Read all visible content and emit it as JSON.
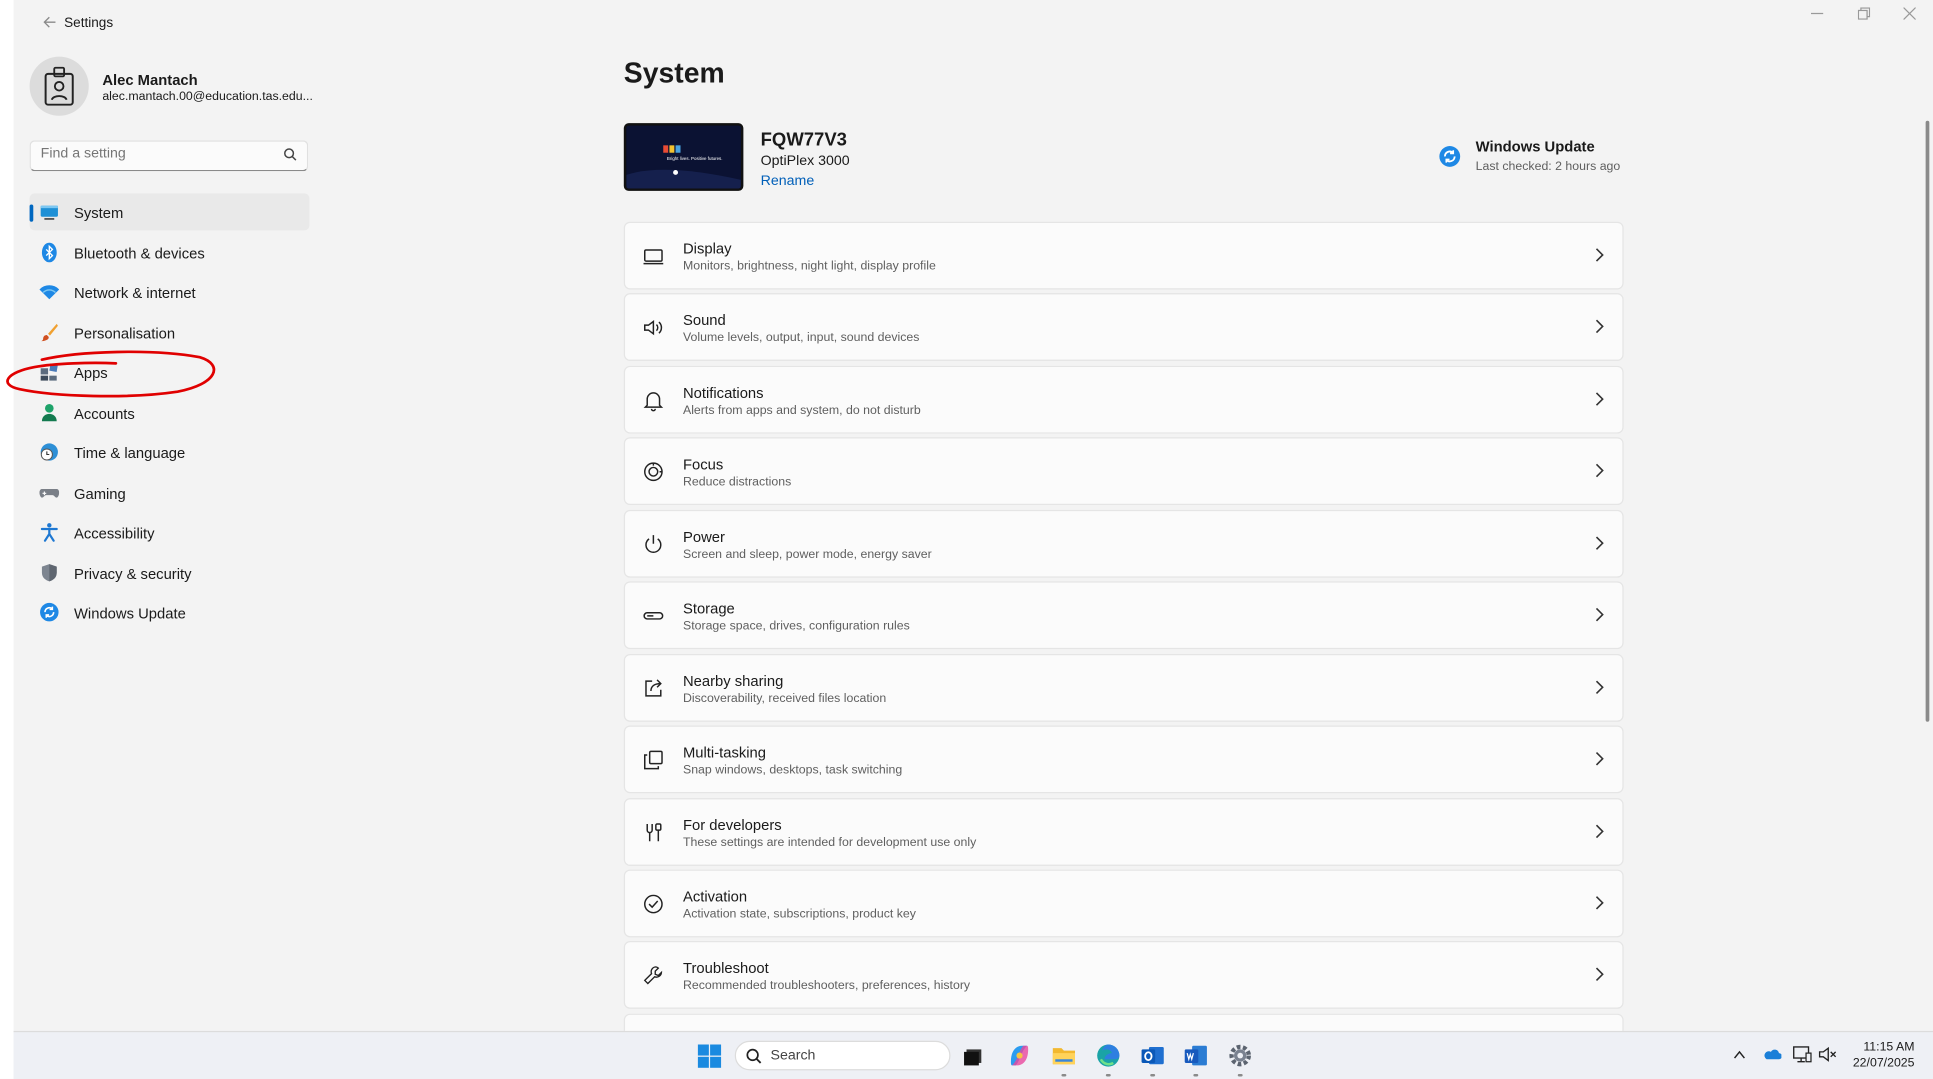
{
  "window": {
    "title": "Settings",
    "back_icon": "back-arrow-icon",
    "controls": [
      "minimize-icon",
      "restore-icon",
      "close-icon"
    ]
  },
  "profile": {
    "name": "Alec Mantach",
    "email": "alec.mantach.00@education.tas.edu...."
  },
  "search": {
    "placeholder": "Find a setting"
  },
  "nav": {
    "items": [
      {
        "label": "System",
        "icon": "system-display-icon",
        "active": true
      },
      {
        "label": "Bluetooth & devices",
        "icon": "bluetooth-icon"
      },
      {
        "label": "Network & internet",
        "icon": "wifi-icon"
      },
      {
        "label": "Personalisation",
        "icon": "paintbrush-icon"
      },
      {
        "label": "Apps",
        "icon": "apps-icon"
      },
      {
        "label": "Accounts",
        "icon": "person-icon"
      },
      {
        "label": "Time & language",
        "icon": "globe-clock-icon"
      },
      {
        "label": "Gaming",
        "icon": "gamepad-icon"
      },
      {
        "label": "Accessibility",
        "icon": "accessibility-icon"
      },
      {
        "label": "Privacy & security",
        "icon": "shield-icon"
      },
      {
        "label": "Windows Update",
        "icon": "windows-update-icon"
      }
    ]
  },
  "annotation": {
    "description": "red hand-drawn circle around Apps",
    "color": "#e00000"
  },
  "main": {
    "title": "System",
    "device": {
      "name": "FQW77V3",
      "model": "OptiPlex 3000",
      "rename_label": "Rename",
      "wallpaper_text": "Bright lives. Positive futures."
    },
    "windows_update": {
      "title": "Windows Update",
      "status": "Last checked: 2 hours ago"
    },
    "cards": [
      {
        "title": "Display",
        "subtitle": "Monitors, brightness, night light, display profile",
        "icon": "display-icon"
      },
      {
        "title": "Sound",
        "subtitle": "Volume levels, output, input, sound devices",
        "icon": "speaker-icon"
      },
      {
        "title": "Notifications",
        "subtitle": "Alerts from apps and system, do not disturb",
        "icon": "bell-icon"
      },
      {
        "title": "Focus",
        "subtitle": "Reduce distractions",
        "icon": "focus-icon"
      },
      {
        "title": "Power",
        "subtitle": "Screen and sleep, power mode, energy saver",
        "icon": "power-icon"
      },
      {
        "title": "Storage",
        "subtitle": "Storage space, drives, configuration rules",
        "icon": "storage-icon"
      },
      {
        "title": "Nearby sharing",
        "subtitle": "Discoverability, received files location",
        "icon": "share-icon"
      },
      {
        "title": "Multi-tasking",
        "subtitle": "Snap windows, desktops, task switching",
        "icon": "multitasking-icon"
      },
      {
        "title": "For developers",
        "subtitle": "These settings are intended for development use only",
        "icon": "developer-tools-icon"
      },
      {
        "title": "Activation",
        "subtitle": "Activation state, subscriptions, product key",
        "icon": "check-circle-icon"
      },
      {
        "title": "Troubleshoot",
        "subtitle": "Recommended troubleshooters, preferences, history",
        "icon": "wrench-icon"
      }
    ]
  },
  "taskbar": {
    "search_label": "Search",
    "apps": [
      "start-icon",
      "task-view-icon",
      "copilot-icon",
      "file-explorer-icon",
      "edge-icon",
      "outlook-icon",
      "word-icon",
      "settings-icon"
    ],
    "tray": [
      "chevron-up-icon",
      "onedrive-icon",
      "network-icon",
      "volume-mute-icon"
    ],
    "time": "11:15 AM",
    "date": "22/07/2025"
  },
  "colors": {
    "accent": "#0067c0",
    "link": "#005fb8",
    "background": "#f3f3f3",
    "card": "#fbfbfb"
  }
}
